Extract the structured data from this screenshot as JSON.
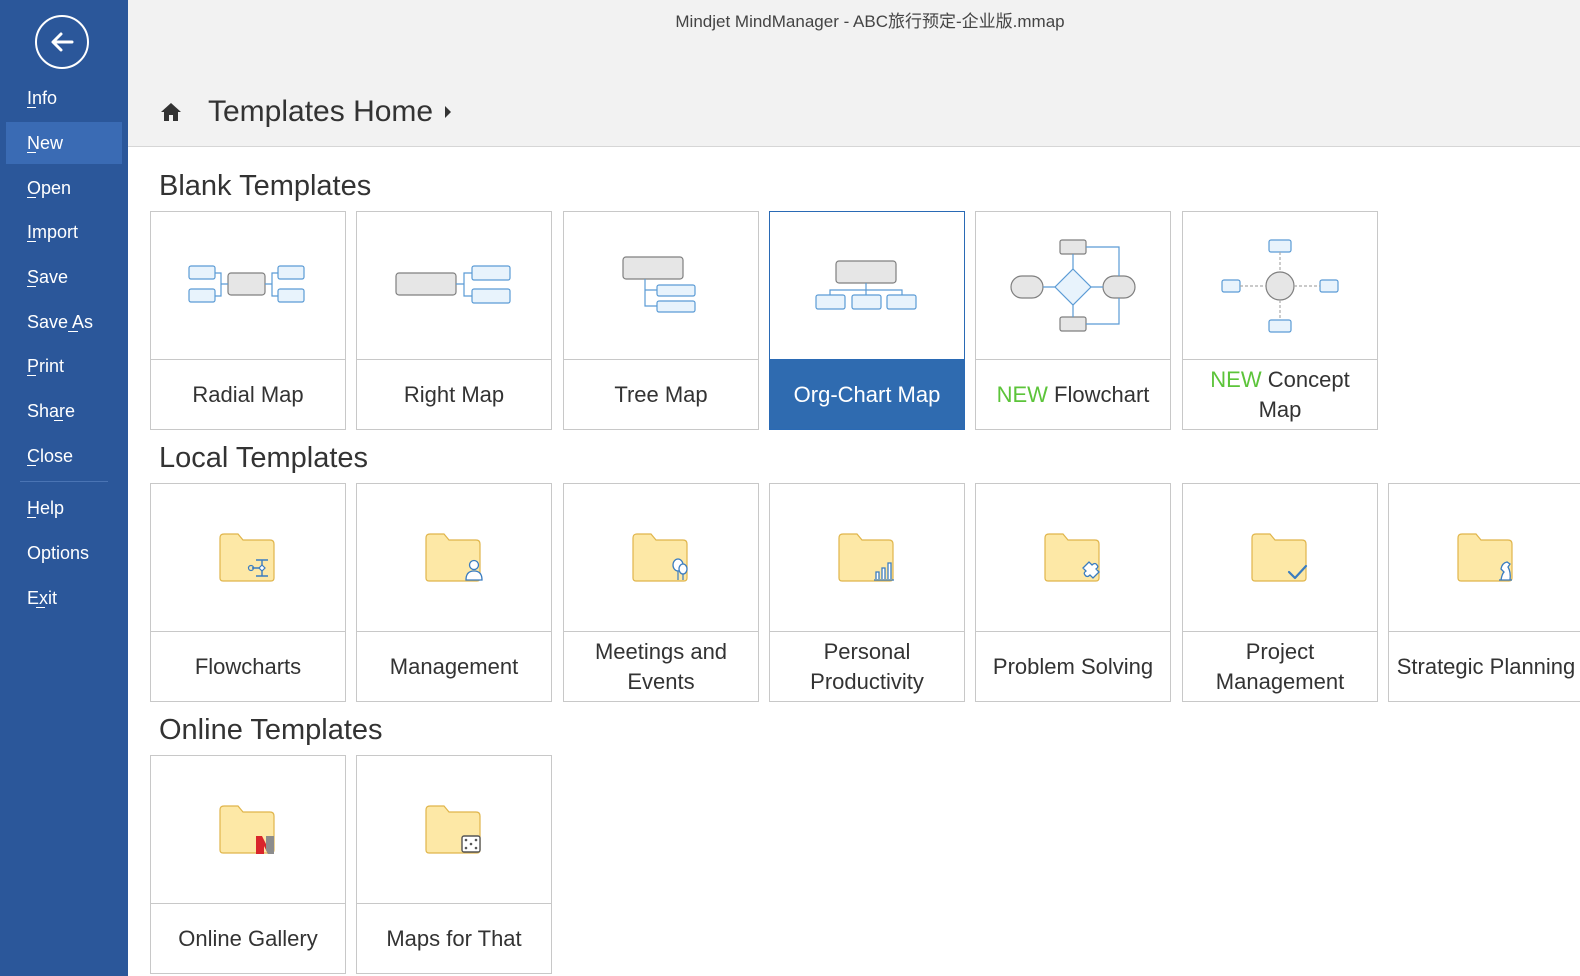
{
  "window": {
    "title": "Mindjet MindManager - ABC旅行预定-企业版.mmap"
  },
  "sidebar": {
    "back_icon": "back-arrow-icon",
    "items": [
      {
        "label": "Info",
        "selected": false
      },
      {
        "label": "New",
        "selected": true
      },
      {
        "label": "Open",
        "selected": false
      },
      {
        "label": "Import",
        "selected": false
      },
      {
        "label": "Save",
        "selected": false
      },
      {
        "label": "Save As",
        "selected": false
      },
      {
        "label": "Print",
        "selected": false
      },
      {
        "label": "Share",
        "selected": false
      },
      {
        "label": "Close",
        "selected": false
      },
      {
        "label": "Help",
        "selected": false
      },
      {
        "label": "Options",
        "selected": false
      },
      {
        "label": "Exit",
        "selected": false
      }
    ]
  },
  "breadcrumb": {
    "home_icon": "home-icon",
    "label": "Templates Home"
  },
  "sections": {
    "blank": {
      "title": "Blank Templates",
      "tiles": [
        {
          "label": "Radial Map",
          "icon": "radial-map-icon"
        },
        {
          "label": "Right Map",
          "icon": "right-map-icon"
        },
        {
          "label": "Tree Map",
          "icon": "tree-map-icon"
        },
        {
          "label": "Org-Chart Map",
          "icon": "org-chart-map-icon",
          "selected": true
        },
        {
          "new_tag": "NEW",
          "label": "Flowchart",
          "icon": "flowchart-icon"
        },
        {
          "new_tag": "NEW",
          "label": "Concept",
          "label2": "Map",
          "icon": "concept-map-icon"
        }
      ]
    },
    "local": {
      "title": "Local Templates",
      "tiles": [
        {
          "label": "Flowcharts",
          "icon": "flowcharts-folder-icon"
        },
        {
          "label": "Management",
          "icon": "management-folder-icon"
        },
        {
          "label": "Meetings and Events",
          "icon": "meetings-folder-icon"
        },
        {
          "label": "Personal Productivity",
          "icon": "productivity-folder-icon"
        },
        {
          "label": "Problem Solving",
          "icon": "problem-solving-folder-icon"
        },
        {
          "label": "Project Management",
          "icon": "project-management-folder-icon"
        },
        {
          "label": "Strategic Planning",
          "icon": "strategic-planning-folder-icon"
        }
      ]
    },
    "online": {
      "title": "Online Templates",
      "tiles": [
        {
          "label": "Online Gallery",
          "icon": "online-gallery-folder-icon"
        },
        {
          "label": "Maps for That",
          "icon": "maps-for-that-folder-icon"
        }
      ]
    }
  },
  "colors": {
    "sidebar": "#2b579a",
    "selected": "#2f6bb0",
    "new_tag": "#5cc43a"
  }
}
